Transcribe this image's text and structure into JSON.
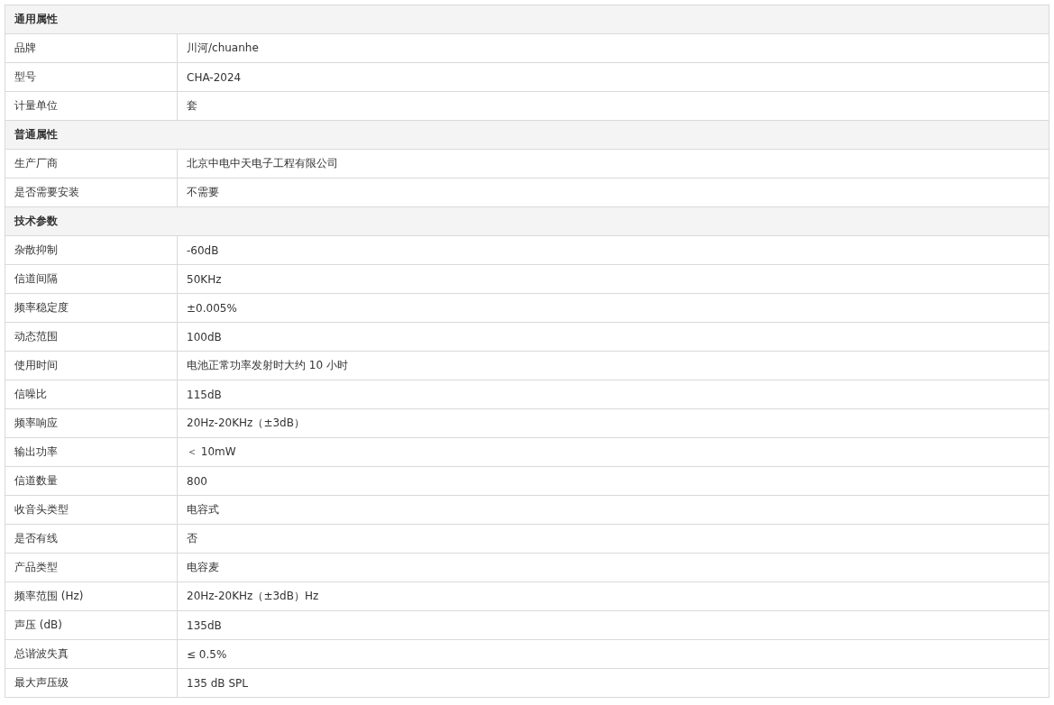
{
  "sections": [
    {
      "title": "通用属性",
      "rows": [
        {
          "name": "品牌",
          "value": "川河/chuanhe"
        },
        {
          "name": "型号",
          "value": "CHA-2024"
        },
        {
          "name": "计量单位",
          "value": "套"
        }
      ]
    },
    {
      "title": "普通属性",
      "rows": [
        {
          "name": "生产厂商",
          "value": "北京中电中天电子工程有限公司"
        },
        {
          "name": "是否需要安装",
          "value": "不需要"
        }
      ]
    },
    {
      "title": "技术参数",
      "rows": [
        {
          "name": "杂散抑制",
          "value": "-60dB"
        },
        {
          "name": "信道间隔",
          "value": "50KHz"
        },
        {
          "name": "频率稳定度",
          "value": "±0.005%"
        },
        {
          "name": "动态范围",
          "value": "100dB"
        },
        {
          "name": "使用时间",
          "value": "电池正常功率发射时大约 10 小时"
        },
        {
          "name": "信噪比",
          "value": "115dB"
        },
        {
          "name": "频率响应",
          "value": "20Hz-20KHz（±3dB）"
        },
        {
          "name": "输出功率",
          "value": "＜ 10mW"
        },
        {
          "name": "信道数量",
          "value": "800"
        },
        {
          "name": "收音头类型",
          "value": "电容式"
        },
        {
          "name": "是否有线",
          "value": "否"
        },
        {
          "name": "产品类型",
          "value": "电容麦"
        },
        {
          "name": "频率范围 (Hz)",
          "value": "20Hz-20KHz（±3dB）Hz"
        },
        {
          "name": "声压 (dB)",
          "value": "135dB"
        },
        {
          "name": "总谐波失真",
          "value": "≤ 0.5%"
        },
        {
          "name": "最大声压级",
          "value": "135 dB SPL"
        }
      ]
    }
  ]
}
